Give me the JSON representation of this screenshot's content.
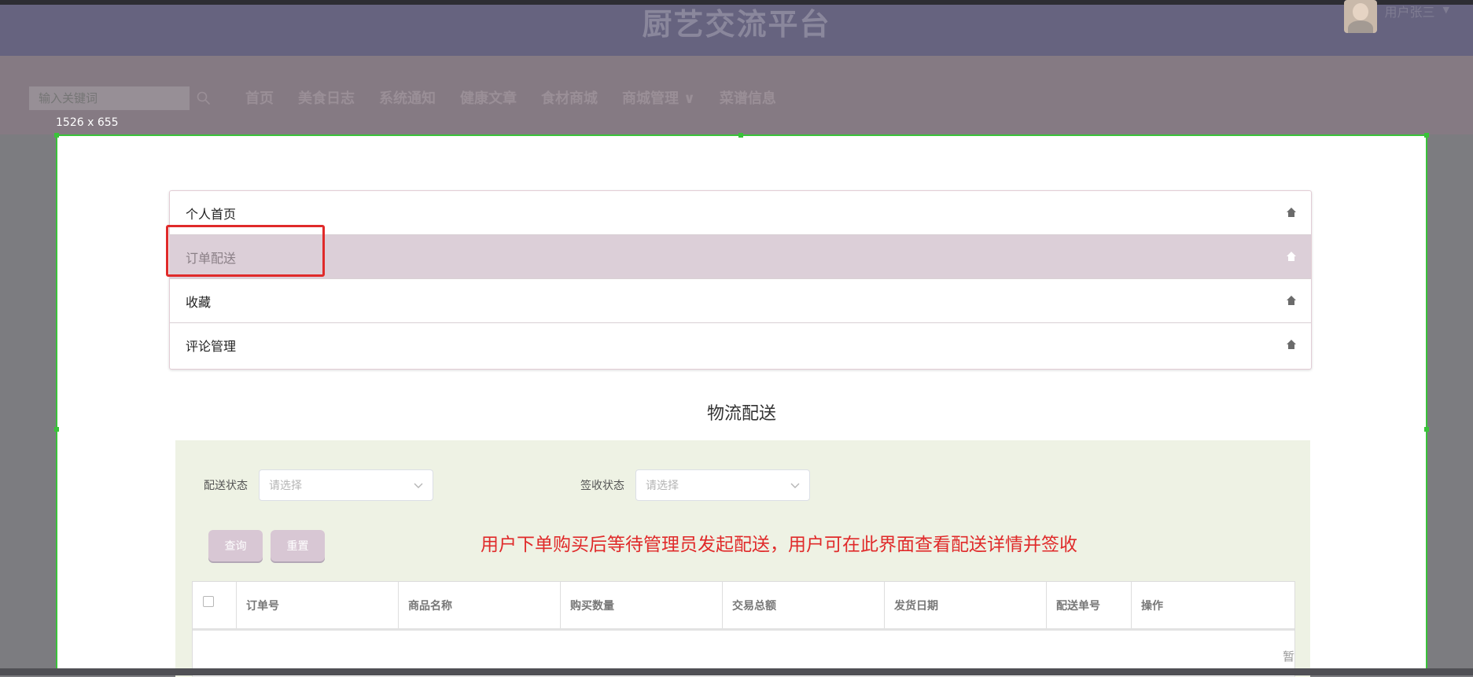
{
  "header": {
    "title": "厨艺交流平台",
    "username": "用户张三",
    "caret": "▼"
  },
  "nav": {
    "search_placeholder": "输入关键词",
    "items": [
      "首页",
      "美食日志",
      "系统通知",
      "健康文章",
      "食材商城",
      "商城管理 ∨",
      "菜谱信息"
    ]
  },
  "overlay": {
    "dimension_label": "1526 x 655"
  },
  "menu": {
    "items": [
      {
        "label": "个人首页",
        "icon": "home-icon",
        "active": false
      },
      {
        "label": "订单配送",
        "icon": "home-icon",
        "active": true
      },
      {
        "label": "收藏",
        "icon": "home-icon",
        "active": false
      },
      {
        "label": "评论管理",
        "icon": "home-icon",
        "active": false
      }
    ]
  },
  "section": {
    "title": "物流配送"
  },
  "filters": {
    "delivery_status_label": "配送状态",
    "delivery_status_placeholder": "请选择",
    "receipt_status_label": "签收状态",
    "receipt_status_placeholder": "请选择",
    "query_button": "查询",
    "reset_button": "重置"
  },
  "annotation": "用户下单购买后等待管理员发起配送，用户可在此界面查看配送详情并签收",
  "table": {
    "columns": [
      "订单号",
      "商品名称",
      "购买数量",
      "交易总额",
      "发货日期",
      "配送单号",
      "操作"
    ],
    "empty_text": "暂"
  },
  "colors": {
    "header_bg": "#66637f",
    "nav_bg": "#857a83",
    "active_menu_bg": "#dccfd8",
    "filter_panel_bg": "#eef2e4",
    "annotation_red": "#e02a2a",
    "selection_green": "#39c239"
  }
}
